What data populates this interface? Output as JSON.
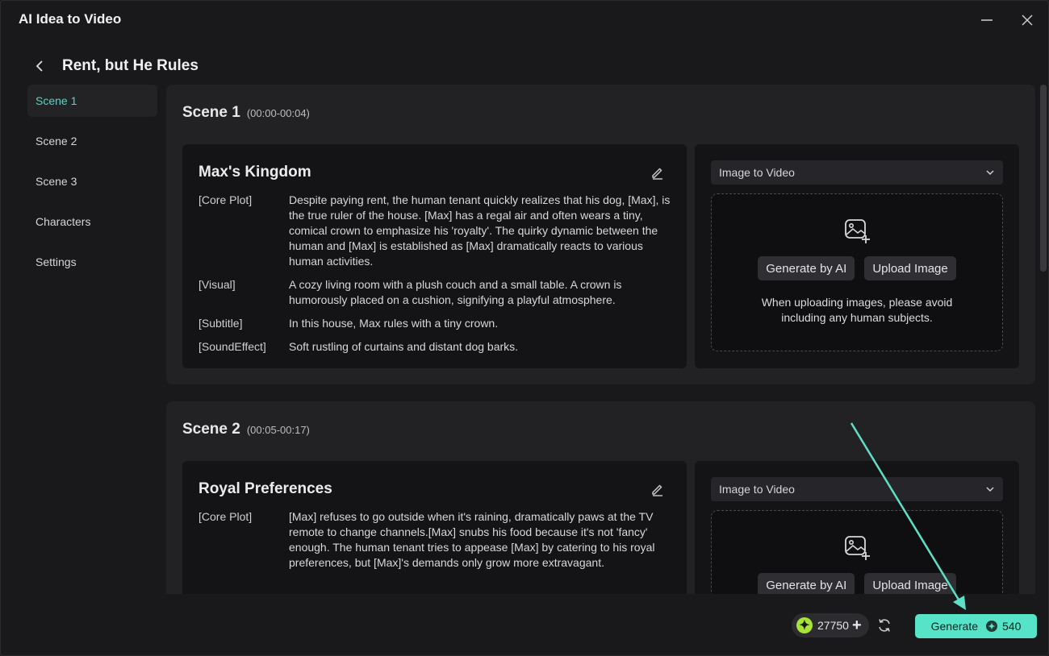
{
  "window": {
    "title": "AI Idea to Video"
  },
  "header": {
    "project_title": "Rent, but He Rules"
  },
  "sidebar": {
    "items": [
      {
        "label": "Scene 1",
        "active": true
      },
      {
        "label": "Scene 2",
        "active": false
      },
      {
        "label": "Scene 3",
        "active": false
      },
      {
        "label": "Characters",
        "active": false
      },
      {
        "label": "Settings",
        "active": false
      }
    ]
  },
  "scenes": [
    {
      "name": "Scene 1",
      "time": "(00:00-00:04)",
      "title": "Max's Kingdom",
      "rows": [
        {
          "tag": "[Core Plot]",
          "text": "Despite paying rent, the human tenant quickly realizes that his dog, [Max], is the true ruler of the house. [Max] has a regal air and often wears a tiny, comical crown to emphasize his 'royalty'. The quirky dynamic between the human and [Max] is established as [Max] dramatically reacts to various human activities."
        },
        {
          "tag": "[Visual]",
          "text": "A cozy living room with a plush couch and a small table. A crown is humorously placed on a cushion, signifying a playful atmosphere."
        },
        {
          "tag": "[Subtitle]",
          "text": "In this house, Max rules with a tiny crown."
        },
        {
          "tag": "[SoundEffect]",
          "text": "Soft rustling of curtains and distant dog barks."
        }
      ],
      "mode": "Image to Video",
      "generate_ai_label": "Generate by AI",
      "upload_label": "Upload Image",
      "note": "When uploading images, please avoid including any human subjects."
    },
    {
      "name": "Scene 2",
      "time": "(00:05-00:17)",
      "title": "Royal Preferences",
      "rows": [
        {
          "tag": "[Core Plot]",
          "text": "[Max] refuses to go outside when it's raining, dramatically paws at the TV remote to change channels.[Max] snubs his food because it's not 'fancy' enough. The human tenant tries to appease [Max] by catering to his royal preferences, but [Max]'s demands only grow more extravagant."
        }
      ],
      "mode": "Image to Video",
      "generate_ai_label": "Generate by AI",
      "upload_label": "Upload Image"
    }
  ],
  "footer": {
    "credits": "27750",
    "generate_label": "Generate",
    "generate_cost": "540"
  },
  "colors": {
    "accent": "#57e3c8",
    "active_text": "#52d8c1",
    "coin": "#a8e33a",
    "background": "#19191b"
  },
  "icons": [
    "minimize-icon",
    "close-icon",
    "back-arrow-icon",
    "edit-icon",
    "chevron-down-icon",
    "image-add-icon",
    "coin-icon",
    "plus-icon",
    "refresh-icon"
  ]
}
